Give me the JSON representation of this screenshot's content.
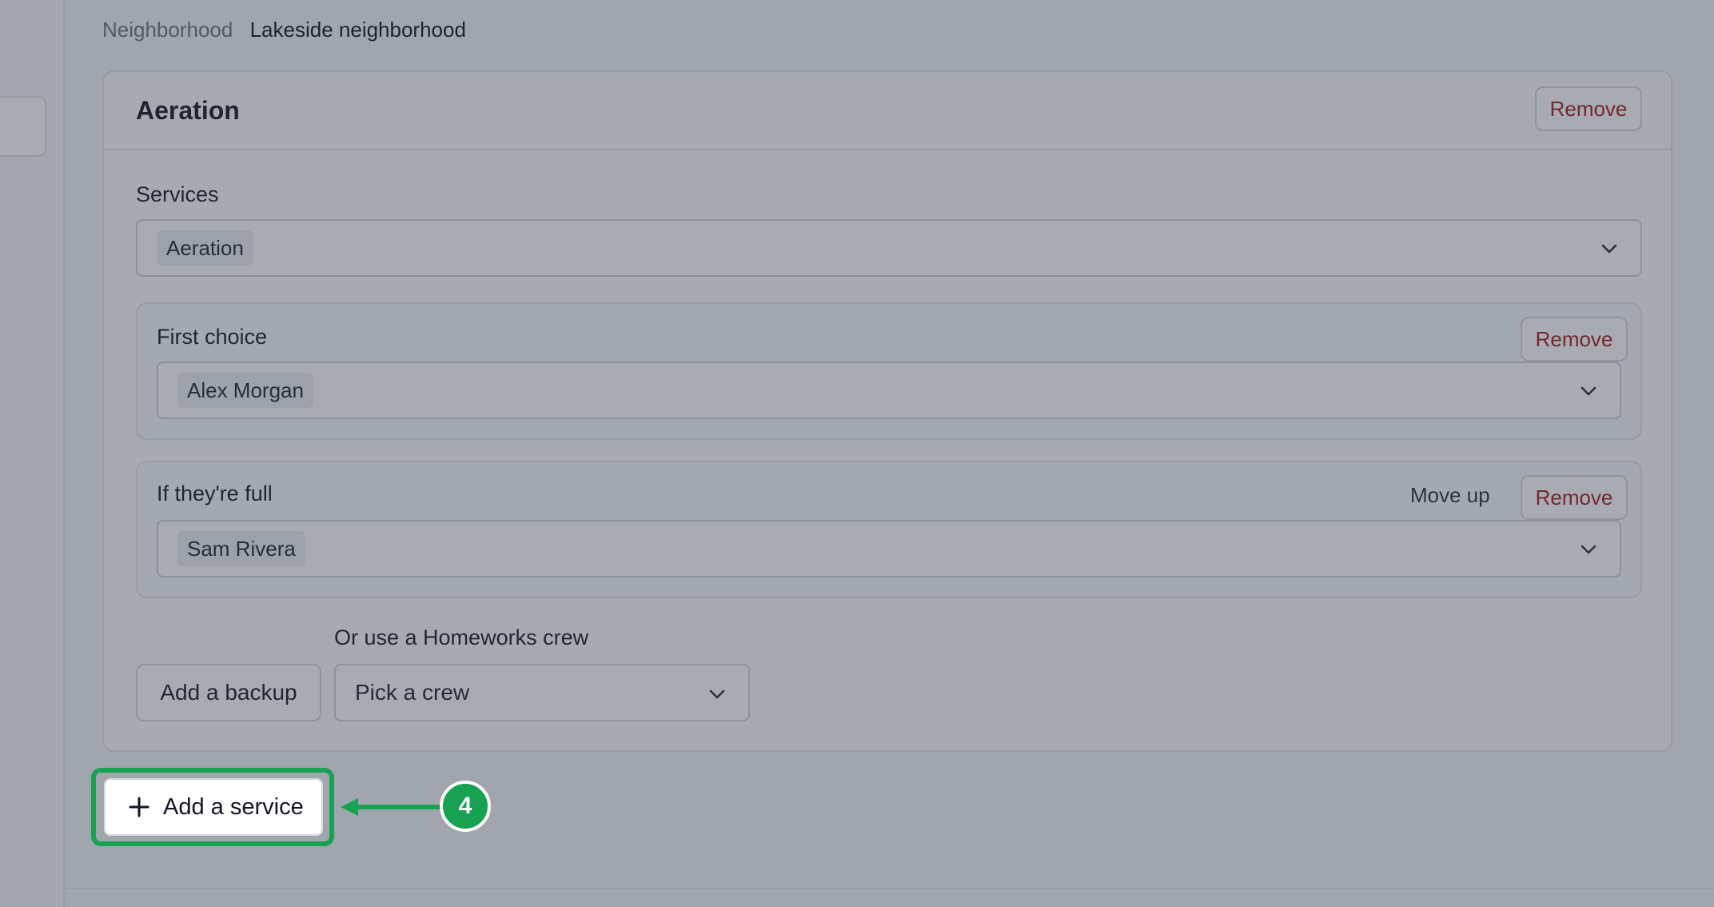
{
  "neighborhood": {
    "label": "Neighborhood",
    "value": "Lakeside neighborhood"
  },
  "service_card": {
    "title": "Aeration",
    "remove_label": "Remove",
    "services": {
      "label": "Services",
      "selected": "Aeration"
    },
    "first_choice": {
      "label": "First choice",
      "remove_label": "Remove",
      "selected": "Alex Morgan"
    },
    "backup": {
      "label": "If they're full",
      "move_up_label": "Move up",
      "remove_label": "Remove",
      "selected": "Sam Rivera"
    },
    "add_backup_label": "Add a backup",
    "crew": {
      "label": "Or use a Homeworks crew",
      "placeholder": "Pick a crew"
    }
  },
  "add_service": {
    "label": "Add a service"
  },
  "callout": {
    "step": "4",
    "color": "#17a251"
  },
  "colors": {
    "remove_text": "#a31f1f",
    "highlight": "#17a251"
  },
  "icons": {
    "plus": "plus-icon",
    "chevron": "chevron-down-icon",
    "arrow": "arrow-left-icon"
  }
}
